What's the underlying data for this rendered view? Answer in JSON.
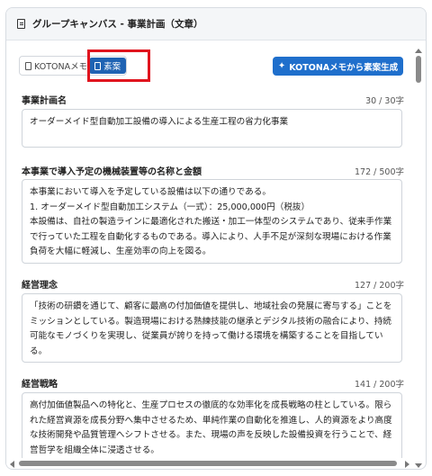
{
  "header": {
    "title": "グループキャンバス - 事業計画（文章）"
  },
  "tabs": [
    {
      "label": "KOTONAメモ"
    },
    {
      "label": "素案"
    }
  ],
  "generate_button": {
    "label": "KOTONAメモから素案生成"
  },
  "fields": [
    {
      "label": "事業計画名",
      "count": "30 / 30字",
      "lines": [
        "オーダーメイド型自動加工設備の導入による生産工程の省力化事業"
      ]
    },
    {
      "label": "本事業で導入予定の機械装置等の名称と金額",
      "count": "172 / 500字",
      "lines": [
        "本事業において導入を予定している設備は以下の通りである。",
        "1. オーダーメイド型自動加工システム（一式）：25,000,000円（税抜）",
        "本設備は、自社の製造ラインに最適化された搬送・加工一体型のシステムであり、従来手作業",
        "で行っていた工程を自動化するものである。導入により、人手不足が深刻な現場における作業",
        "負荷を大幅に軽減し、生産効率の向上を図る。"
      ]
    },
    {
      "label": "経営理念",
      "count": "127 / 200字",
      "lines": [
        "「技術の研鑽を通じて、顧客に最高の付加価値を提供し、地域社会の発展に寄与する」ことを",
        "ミッションとしている。製造現場における熟練技能の継承とデジタル技術の融合により、持続",
        "可能なモノづくりを実現し、従業員が誇りを持って働ける環境を構築することを目指してい",
        "る。"
      ]
    },
    {
      "label": "経営戦略",
      "count": "141 / 200字",
      "lines": [
        "高付加価値製品への特化と、生産プロセスの徹底的な効率化を成長戦略の柱としている。限ら",
        "れた経営資源を成長分野へ集中させるため、単純作業の自動化を推進し、人的資源をより高度",
        "な技術開発や品質管理へシフトさせる。また、現場の声を反映した設備投資を行うことで、経",
        "営哲学を組織全体に浸透させる。"
      ]
    }
  ]
}
